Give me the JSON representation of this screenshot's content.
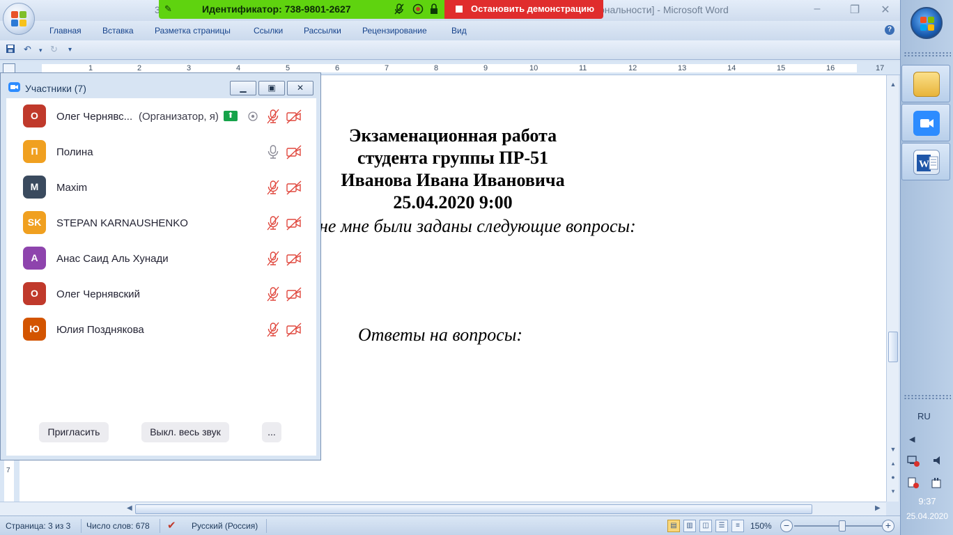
{
  "window": {
    "title": "Microsoft Word",
    "doc_prefix": "3",
    "doc_suffix": "ональности] -",
    "controls": [
      "–",
      "❐",
      "✕"
    ]
  },
  "share_toolbar": {
    "meeting_id": "Идентификатор: 738-9801-2627",
    "stop_label": "Остановить демонстрацию",
    "accent_green": "#5fd30f",
    "accent_red": "#e02d2d"
  },
  "ribbon": {
    "tabs": [
      "Главная",
      "Вставка",
      "Разметка страницы",
      "Ссылки",
      "Рассылки",
      "Рецензирование",
      "Вид"
    ],
    "help": "?"
  },
  "ruler": {
    "numbers": [
      "1",
      "2",
      "3",
      "4",
      "5",
      "6",
      "7",
      "8",
      "9",
      "10",
      "11",
      "12",
      "13",
      "14",
      "15",
      "16",
      "17"
    ],
    "vertical_number": "7"
  },
  "document": {
    "lines": [
      "Экзаменационная работа",
      "студента группы ПР-51",
      "Иванова Ивана Ивановича",
      "25.04.2020 9:00"
    ],
    "question_line": "не мне были заданы следующие вопросы:",
    "answers_heading": "Ответы на вопросы:"
  },
  "participants_panel": {
    "title": "Участники (7)",
    "participants": [
      {
        "initial": "О",
        "name": "Олег Чернявс...",
        "role": "(Организатор, я)",
        "color": "#c0392b",
        "mic": "muted",
        "video": "off",
        "host": true
      },
      {
        "initial": "П",
        "name": "Полина",
        "role": "",
        "color": "#f0a020",
        "mic": "on",
        "video": "off",
        "host": false
      },
      {
        "initial": "M",
        "name": "Maxim",
        "role": "",
        "color": "#3a4a5e",
        "mic": "muted",
        "video": "off",
        "host": false
      },
      {
        "initial": "SK",
        "name": "STEPAN KARNAUSHENKO",
        "role": "",
        "color": "#f0a020",
        "mic": "muted",
        "video": "off",
        "host": false
      },
      {
        "initial": "А",
        "name": "Анас Саид Аль Хунади",
        "role": "",
        "color": "#8e44ad",
        "mic": "muted",
        "video": "off",
        "host": false
      },
      {
        "initial": "О",
        "name": "Олег Чернявский",
        "role": "",
        "color": "#c0392b",
        "mic": "muted",
        "video": "off",
        "host": false
      },
      {
        "initial": "Ю",
        "name": "Юлия Позднякова",
        "role": "",
        "color": "#d35400",
        "mic": "muted",
        "video": "off",
        "host": false
      }
    ],
    "buttons": {
      "invite": "Пригласить",
      "mute_all": "Выкл. весь звук",
      "more": "..."
    }
  },
  "status_bar": {
    "page": "Страница: 3 из 3",
    "words": "Число слов: 678",
    "language": "Русский (Россия)",
    "zoom": "150%",
    "zoom_level_percent": 150
  },
  "taskbar": {
    "language": "RU",
    "time": "9:37",
    "date": "25.04.2020"
  }
}
